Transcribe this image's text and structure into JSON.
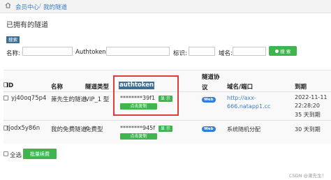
{
  "breadcrumb": {
    "home": "会员中心",
    "current": "我的隧道"
  },
  "page_title": "已拥有的隧道",
  "search": {
    "tag": "搜索",
    "name_label": "名称:",
    "authtoken_label": "Authtoken:",
    "tag_label": "标识:",
    "domain_label": "域名:",
    "button_label": "搜 索"
  },
  "table": {
    "headers": {
      "id": "ID",
      "name": "名称",
      "type": "隧道类型",
      "authtoken": "authtoken",
      "protocol_1": "隧道协",
      "protocol_2": "议",
      "domain": "域名/端口",
      "expire": "到期"
    },
    "rows": [
      {
        "id": "yj40oq75p4",
        "name": "萧先生的隧道",
        "type": "VIP_1 型",
        "token": "********39f1",
        "show": "显 示",
        "copy": "点击复制",
        "protocol": "Web",
        "domain_1": "http://axx-",
        "domain_2": "666.natapp1.cc",
        "expire_1": "2022-11-11",
        "expire_2": "22:28:20",
        "expire_3": "35 天到期"
      },
      {
        "id": "rjodx5y86n",
        "name": "我的免费隧道",
        "type": "免费型",
        "token": "********945f",
        "show": "显 示",
        "copy": "点击复制",
        "protocol": "Web",
        "domain_1": "系统随机分配",
        "expire_1": "30 天到期"
      }
    ]
  },
  "footer": {
    "select_all": "全选",
    "renew_button": "批量续费"
  },
  "watermark": "CSDN @萧先生！",
  "colors": {
    "accent_green": "#3fb54f",
    "link_blue": "#3a7fc8",
    "highlight_red": "#e23b3b",
    "badge_blue": "#2f7fd8"
  }
}
